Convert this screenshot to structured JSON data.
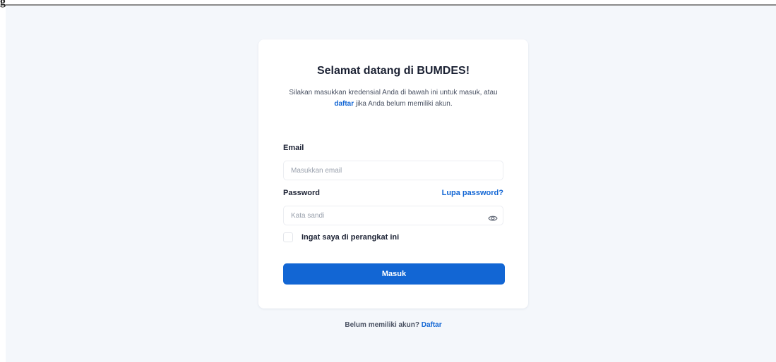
{
  "top_fragment": "g",
  "card": {
    "title": "Selamat datang di BUMDES!",
    "subtitle_before": "Silakan masukkan kredensial Anda di bawah ini untuk masuk, atau ",
    "subtitle_link": "daftar",
    "subtitle_after": " jika Anda belum memiliki akun."
  },
  "form": {
    "email_label": "Email",
    "email_placeholder": "Masukkan email",
    "email_value": "",
    "password_label": "Password",
    "forgot_label": "Lupa password?",
    "password_placeholder": "Kata sandi",
    "password_value": "",
    "password_toggle_icon": "eye-icon",
    "remember_label": "Ingat saya di perangkat ini",
    "remember_checked": false,
    "submit_label": "Masuk"
  },
  "footer": {
    "prompt": "Belum memiliki akun? ",
    "link": "Daftar"
  },
  "colors": {
    "accent": "#1266d4",
    "background": "#f4f7fb",
    "card": "#ffffff",
    "text": "#1b2133"
  }
}
